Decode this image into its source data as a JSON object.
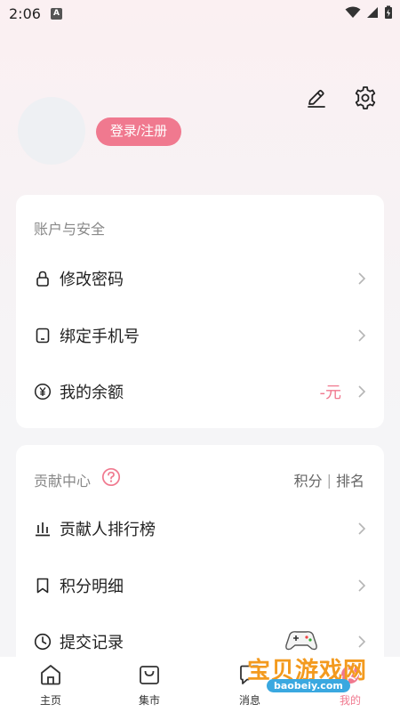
{
  "status_bar": {
    "time": "2:06",
    "notification_badge": "A"
  },
  "header": {
    "login_label": "登录/注册"
  },
  "account_section": {
    "title": "账户与安全",
    "items": [
      {
        "label": "修改密码",
        "icon": "lock-icon"
      },
      {
        "label": "绑定手机号",
        "icon": "phone-icon"
      },
      {
        "label": "我的余额",
        "icon": "yuan-icon",
        "value": "-元"
      }
    ]
  },
  "contribution_section": {
    "title": "贡献中心",
    "score_label": "积分",
    "separator": "|",
    "rank_label": "排名",
    "items": [
      {
        "label": "贡献人排行榜",
        "icon": "bar-chart-icon"
      },
      {
        "label": "积分明细",
        "icon": "bookmark-icon"
      },
      {
        "label": "提交记录",
        "icon": "clock-icon"
      }
    ]
  },
  "bottom_nav": {
    "items": [
      {
        "label": "主页",
        "icon": "home-icon"
      },
      {
        "label": "集市",
        "icon": "shopping-bag-icon"
      },
      {
        "label": "消息",
        "icon": "message-icon"
      },
      {
        "label": "我的",
        "icon": "profile-icon",
        "active": true
      }
    ]
  },
  "watermark": {
    "text": "宝贝游戏网",
    "url": "baobeiy.com"
  },
  "colors": {
    "accent": "#f0798f",
    "watermark_orange": "#f39a1e"
  }
}
